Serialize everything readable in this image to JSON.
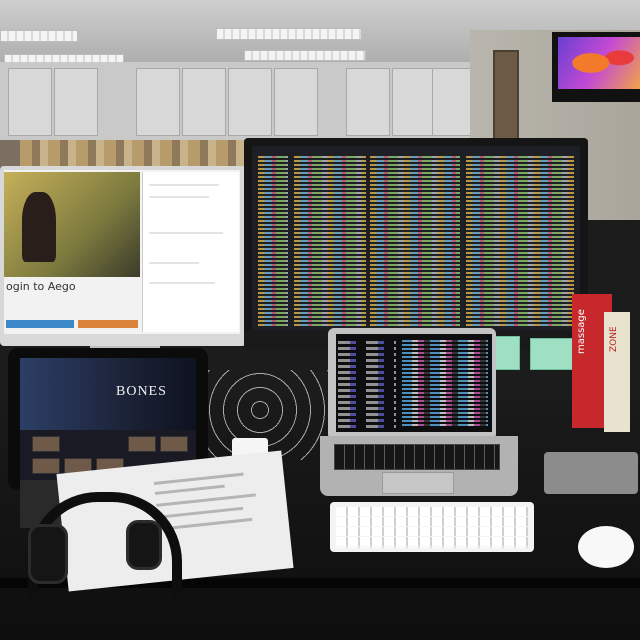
{
  "scene": {
    "description_only_visual": true
  },
  "left_monitor": {
    "video_title": "ogin to Aego"
  },
  "tablet": {
    "show_title": "BONES"
  },
  "books": {
    "book1_spine": "massage",
    "book2_spine": "ZONE"
  },
  "colors": {
    "desk": "#111111",
    "wall": "#b9b6ad",
    "accent_blue": "#3c89c9",
    "accent_orange": "#d9843a",
    "book_red": "#c6282c",
    "cube_green": "#9fe0c4"
  },
  "icons": {
    "headphones": "headphones-icon",
    "mouse": "mouse-icon"
  }
}
